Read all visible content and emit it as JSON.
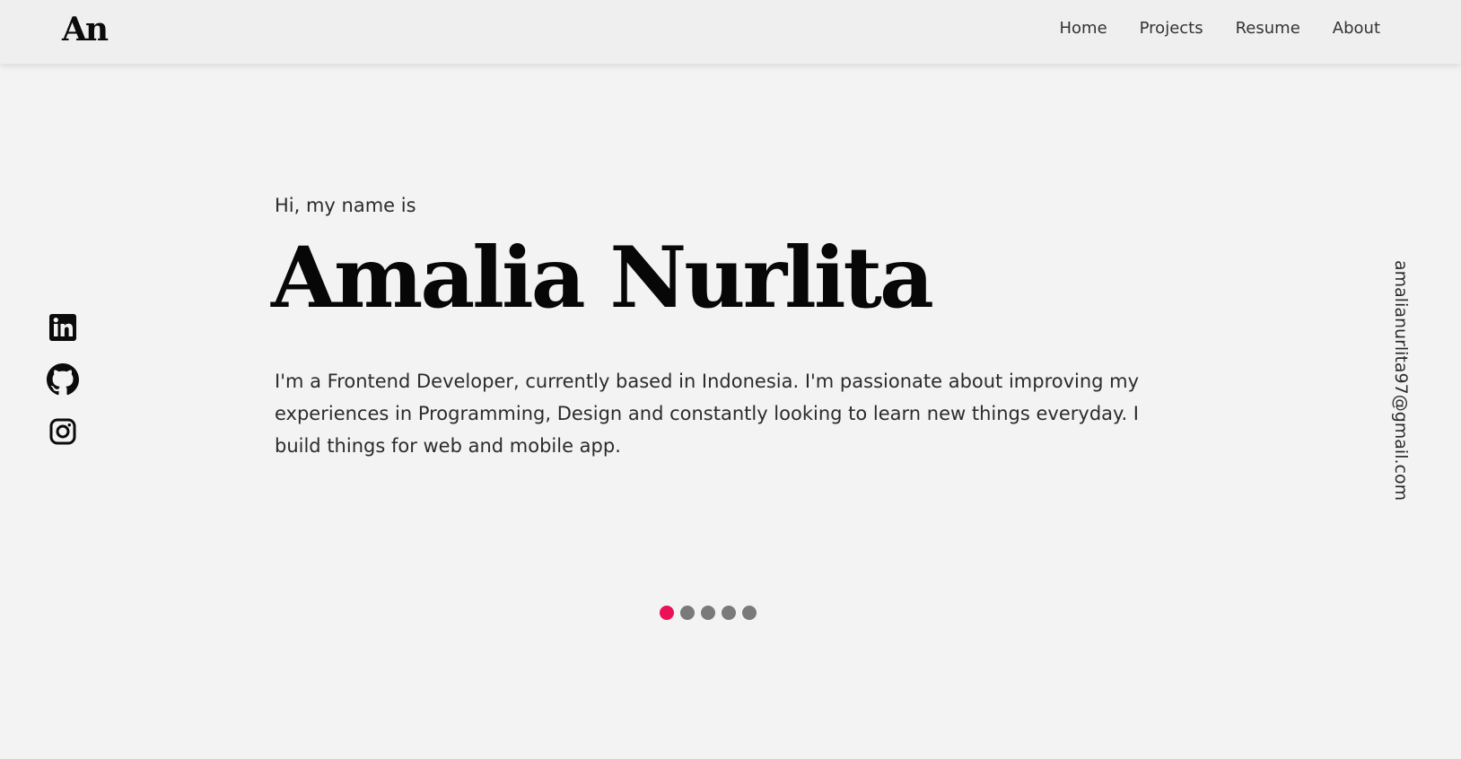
{
  "header": {
    "logo": "An",
    "nav": [
      {
        "label": "Home"
      },
      {
        "label": "Projects"
      },
      {
        "label": "Resume"
      },
      {
        "label": "About"
      }
    ]
  },
  "hero": {
    "greeting": "Hi, my name is",
    "name": "Amalia Nurlita",
    "bio": "I'm a Frontend Developer, currently based in Indonesia. I'm passionate about improving my experiences in Programming, Design and constantly looking to learn new things everyday. I build things for web and mobile app."
  },
  "socials": [
    {
      "icon": "linkedin-icon"
    },
    {
      "icon": "github-icon"
    },
    {
      "icon": "instagram-icon"
    }
  ],
  "contact": {
    "email": "amalianurlita97@gmail.com"
  },
  "carousel": {
    "count": 5,
    "active_index": 0,
    "active_color": "#ec1157",
    "inactive_color": "#7a7a7a"
  }
}
